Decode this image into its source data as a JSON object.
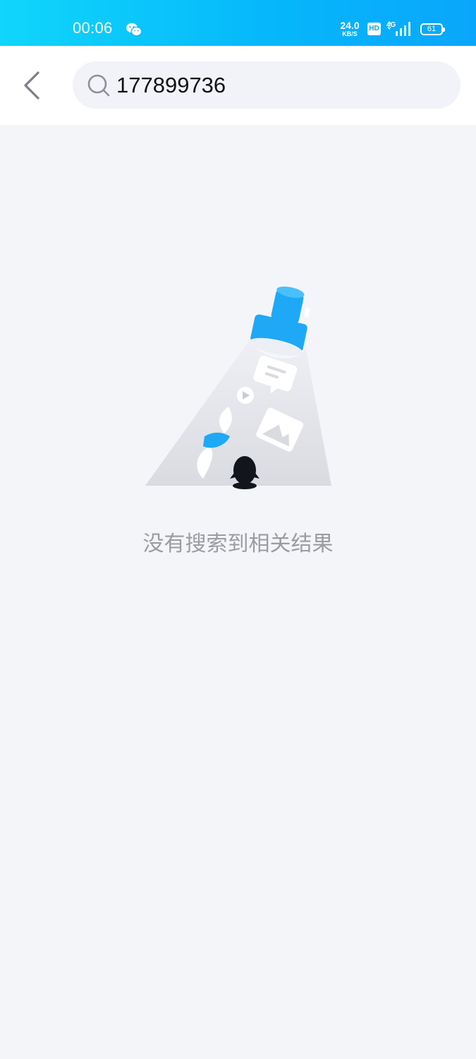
{
  "status_bar": {
    "time": "00:06",
    "app_icon": "wechat-icon",
    "network_speed": "24.0",
    "network_speed_unit": "KB/S",
    "hd_badge": "HD",
    "network_type": "4G",
    "battery_level": "61"
  },
  "header": {
    "back_icon": "chevron-left-icon",
    "search": {
      "icon": "search-icon",
      "value": "177899736"
    }
  },
  "empty_state": {
    "illustration": "flashlight-penguin-illustration",
    "message": "没有搜索到相关结果"
  },
  "colors": {
    "status_bar_gradient_start": "#10d6fb",
    "status_bar_gradient_end": "#0aa6fb",
    "accent": "#1ea8f5",
    "page_background": "#f3f5f9",
    "empty_text": "#9b9ca2"
  }
}
